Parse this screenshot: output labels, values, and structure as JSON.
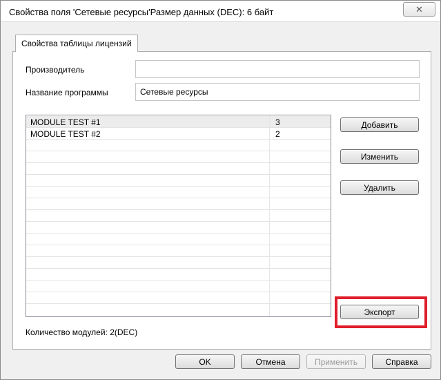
{
  "window": {
    "title": "Свойства поля 'Сетевые ресурсы'Размер данных (DEC): 6 байт",
    "close_glyph": "✕"
  },
  "tab": {
    "label": "Свойства таблицы лицензий"
  },
  "form": {
    "manufacturer_label": "Производитель",
    "manufacturer_value": "",
    "program_label": "Название программы",
    "program_value": "Сетевые ресурсы"
  },
  "list": {
    "rows": [
      {
        "name": "MODULE TEST #1",
        "value": "3"
      },
      {
        "name": "MODULE TEST #2",
        "value": "2"
      }
    ],
    "empty_rows": 14
  },
  "buttons": {
    "add": "Добавить",
    "edit": "Изменить",
    "delete": "Удалить",
    "export": "Экспорт",
    "ok": "OK",
    "cancel": "Отмена",
    "apply": "Применить",
    "help": "Справка"
  },
  "status": {
    "modules_count": "Количество модулей: 2(DEC)"
  },
  "colors": {
    "highlight": "#e01e2b"
  }
}
